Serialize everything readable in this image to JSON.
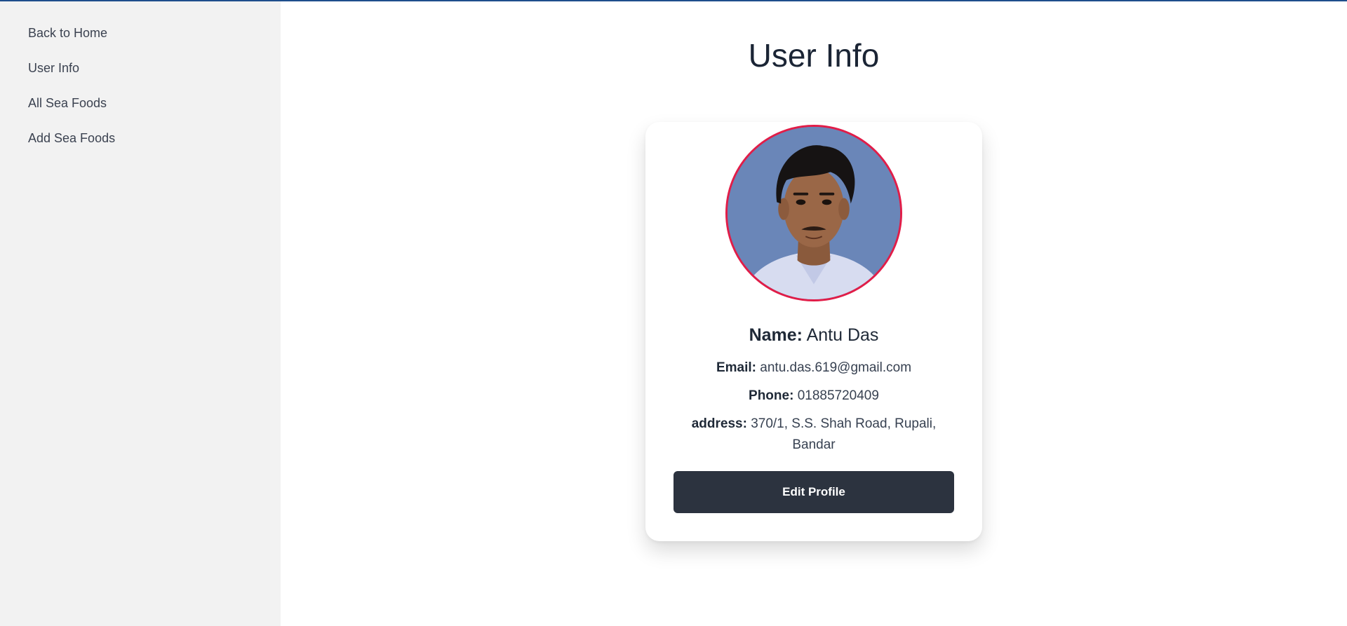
{
  "sidebar": {
    "items": [
      {
        "label": "Back to Home"
      },
      {
        "label": "User Info"
      },
      {
        "label": "All Sea Foods"
      },
      {
        "label": "Add Sea Foods"
      }
    ]
  },
  "main": {
    "title": "User Info"
  },
  "profile": {
    "name_label": "Name:",
    "name": "Antu Das",
    "email_label": "Email:",
    "email": "antu.das.619@gmail.com",
    "phone_label": "Phone:",
    "phone": "01885720409",
    "address_label": "address:",
    "address": "370/1, S.S. Shah Road, Rupali, Bandar",
    "edit_button": "Edit Profile"
  },
  "colors": {
    "sidebar_bg": "#f2f2f2",
    "avatar_border": "#e11d48",
    "button_bg": "#2c333f",
    "top_accent": "#1e4e8c"
  }
}
